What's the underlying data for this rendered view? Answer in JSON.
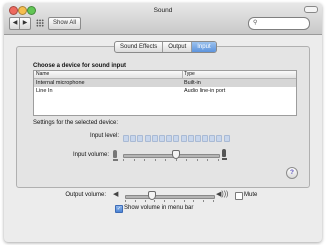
{
  "window": {
    "title": "Sound"
  },
  "toolbar": {
    "back": "◀",
    "forward": "▶",
    "show_all": "Show All"
  },
  "search": {
    "placeholder": ""
  },
  "tabs": [
    {
      "label": "Sound Effects",
      "active": false
    },
    {
      "label": "Output",
      "active": false
    },
    {
      "label": "Input",
      "active": true
    }
  ],
  "input": {
    "section_title": "Choose a device for sound input",
    "columns": [
      "Name",
      "Type"
    ],
    "devices": [
      {
        "name": "Internal microphone",
        "type": "Built-in",
        "selected": true
      },
      {
        "name": "Line In",
        "type": "Audio line-in port",
        "selected": false
      }
    ],
    "settings_label": "Settings for the selected device:",
    "input_level_label": "Input level:",
    "input_level_segments_lit": 0,
    "input_volume_label": "Input volume:",
    "input_volume": 0.55
  },
  "output": {
    "volume_label": "Output volume:",
    "volume": 0.3,
    "mute_label": "Mute",
    "mute": false,
    "show_volume_label": "Show volume in menu bar",
    "show_volume": true
  },
  "help": {
    "label": "?"
  },
  "colors": {
    "selected_tab": "#5d94dd",
    "selected_row": "#d6d6d6"
  }
}
